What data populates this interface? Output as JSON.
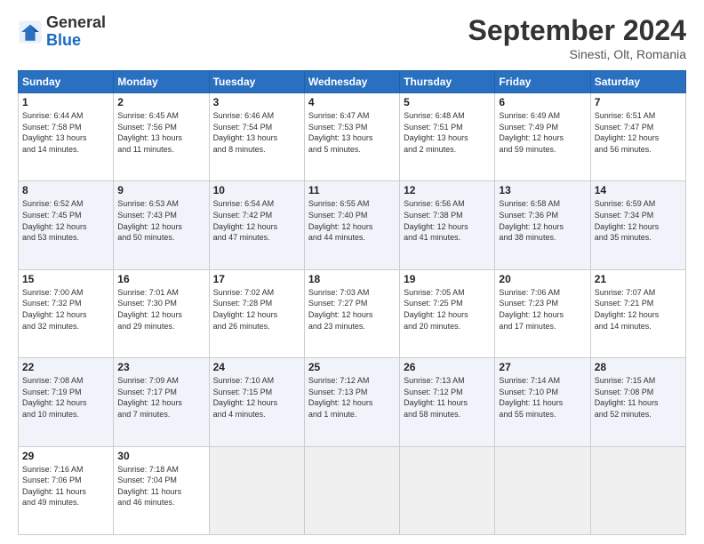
{
  "header": {
    "logo_general": "General",
    "logo_blue": "Blue",
    "month_title": "September 2024",
    "subtitle": "Sinesti, Olt, Romania"
  },
  "weekdays": [
    "Sunday",
    "Monday",
    "Tuesday",
    "Wednesday",
    "Thursday",
    "Friday",
    "Saturday"
  ],
  "weeks": [
    [
      {
        "num": "1",
        "info": "Sunrise: 6:44 AM\nSunset: 7:58 PM\nDaylight: 13 hours\nand 14 minutes."
      },
      {
        "num": "2",
        "info": "Sunrise: 6:45 AM\nSunset: 7:56 PM\nDaylight: 13 hours\nand 11 minutes."
      },
      {
        "num": "3",
        "info": "Sunrise: 6:46 AM\nSunset: 7:54 PM\nDaylight: 13 hours\nand 8 minutes."
      },
      {
        "num": "4",
        "info": "Sunrise: 6:47 AM\nSunset: 7:53 PM\nDaylight: 13 hours\nand 5 minutes."
      },
      {
        "num": "5",
        "info": "Sunrise: 6:48 AM\nSunset: 7:51 PM\nDaylight: 13 hours\nand 2 minutes."
      },
      {
        "num": "6",
        "info": "Sunrise: 6:49 AM\nSunset: 7:49 PM\nDaylight: 12 hours\nand 59 minutes."
      },
      {
        "num": "7",
        "info": "Sunrise: 6:51 AM\nSunset: 7:47 PM\nDaylight: 12 hours\nand 56 minutes."
      }
    ],
    [
      {
        "num": "8",
        "info": "Sunrise: 6:52 AM\nSunset: 7:45 PM\nDaylight: 12 hours\nand 53 minutes."
      },
      {
        "num": "9",
        "info": "Sunrise: 6:53 AM\nSunset: 7:43 PM\nDaylight: 12 hours\nand 50 minutes."
      },
      {
        "num": "10",
        "info": "Sunrise: 6:54 AM\nSunset: 7:42 PM\nDaylight: 12 hours\nand 47 minutes."
      },
      {
        "num": "11",
        "info": "Sunrise: 6:55 AM\nSunset: 7:40 PM\nDaylight: 12 hours\nand 44 minutes."
      },
      {
        "num": "12",
        "info": "Sunrise: 6:56 AM\nSunset: 7:38 PM\nDaylight: 12 hours\nand 41 minutes."
      },
      {
        "num": "13",
        "info": "Sunrise: 6:58 AM\nSunset: 7:36 PM\nDaylight: 12 hours\nand 38 minutes."
      },
      {
        "num": "14",
        "info": "Sunrise: 6:59 AM\nSunset: 7:34 PM\nDaylight: 12 hours\nand 35 minutes."
      }
    ],
    [
      {
        "num": "15",
        "info": "Sunrise: 7:00 AM\nSunset: 7:32 PM\nDaylight: 12 hours\nand 32 minutes."
      },
      {
        "num": "16",
        "info": "Sunrise: 7:01 AM\nSunset: 7:30 PM\nDaylight: 12 hours\nand 29 minutes."
      },
      {
        "num": "17",
        "info": "Sunrise: 7:02 AM\nSunset: 7:28 PM\nDaylight: 12 hours\nand 26 minutes."
      },
      {
        "num": "18",
        "info": "Sunrise: 7:03 AM\nSunset: 7:27 PM\nDaylight: 12 hours\nand 23 minutes."
      },
      {
        "num": "19",
        "info": "Sunrise: 7:05 AM\nSunset: 7:25 PM\nDaylight: 12 hours\nand 20 minutes."
      },
      {
        "num": "20",
        "info": "Sunrise: 7:06 AM\nSunset: 7:23 PM\nDaylight: 12 hours\nand 17 minutes."
      },
      {
        "num": "21",
        "info": "Sunrise: 7:07 AM\nSunset: 7:21 PM\nDaylight: 12 hours\nand 14 minutes."
      }
    ],
    [
      {
        "num": "22",
        "info": "Sunrise: 7:08 AM\nSunset: 7:19 PM\nDaylight: 12 hours\nand 10 minutes."
      },
      {
        "num": "23",
        "info": "Sunrise: 7:09 AM\nSunset: 7:17 PM\nDaylight: 12 hours\nand 7 minutes."
      },
      {
        "num": "24",
        "info": "Sunrise: 7:10 AM\nSunset: 7:15 PM\nDaylight: 12 hours\nand 4 minutes."
      },
      {
        "num": "25",
        "info": "Sunrise: 7:12 AM\nSunset: 7:13 PM\nDaylight: 12 hours\nand 1 minute."
      },
      {
        "num": "26",
        "info": "Sunrise: 7:13 AM\nSunset: 7:12 PM\nDaylight: 11 hours\nand 58 minutes."
      },
      {
        "num": "27",
        "info": "Sunrise: 7:14 AM\nSunset: 7:10 PM\nDaylight: 11 hours\nand 55 minutes."
      },
      {
        "num": "28",
        "info": "Sunrise: 7:15 AM\nSunset: 7:08 PM\nDaylight: 11 hours\nand 52 minutes."
      }
    ],
    [
      {
        "num": "29",
        "info": "Sunrise: 7:16 AM\nSunset: 7:06 PM\nDaylight: 11 hours\nand 49 minutes."
      },
      {
        "num": "30",
        "info": "Sunrise: 7:18 AM\nSunset: 7:04 PM\nDaylight: 11 hours\nand 46 minutes."
      },
      {
        "num": "",
        "info": ""
      },
      {
        "num": "",
        "info": ""
      },
      {
        "num": "",
        "info": ""
      },
      {
        "num": "",
        "info": ""
      },
      {
        "num": "",
        "info": ""
      }
    ]
  ]
}
